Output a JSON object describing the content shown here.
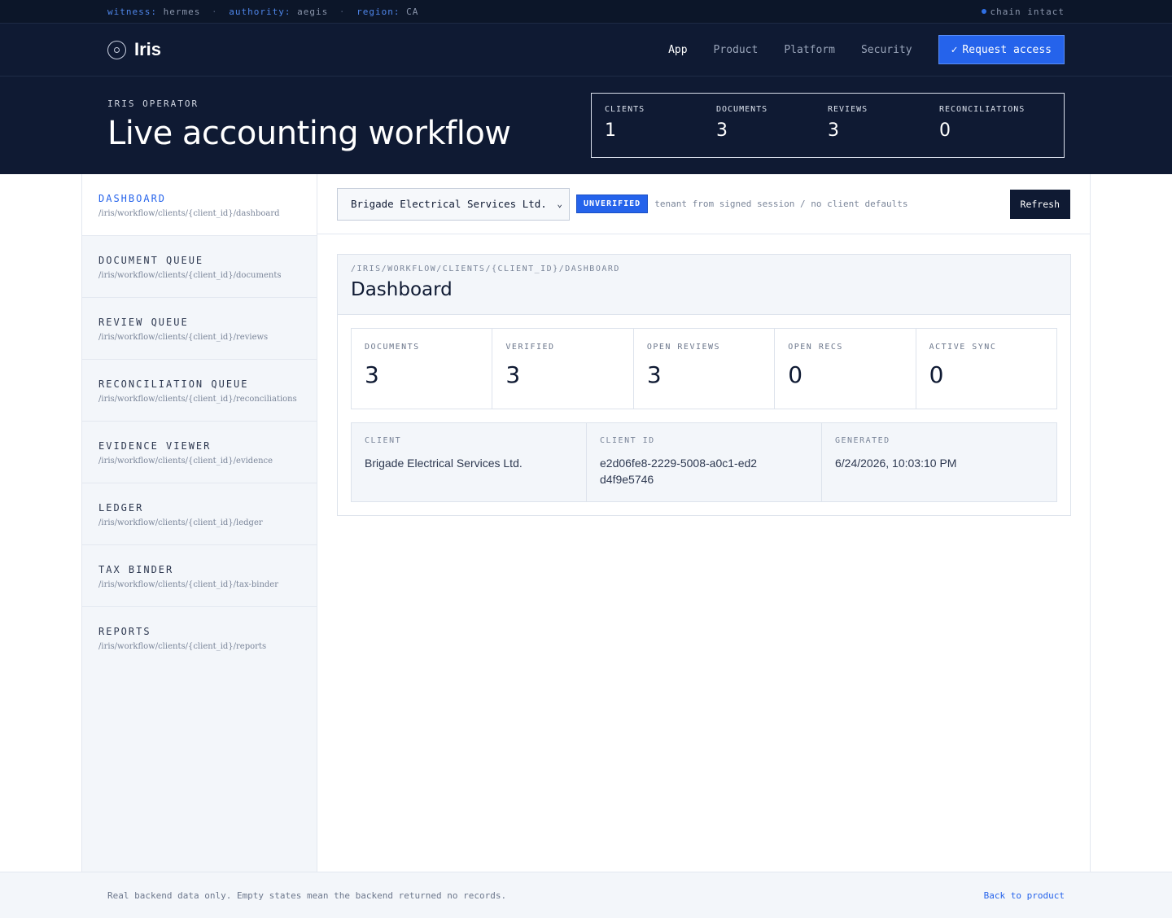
{
  "topstrip": {
    "witness_key": "witness:",
    "witness_val": "hermes",
    "authority_key": "authority:",
    "authority_val": "aegis",
    "region_key": "region:",
    "region_val": "CA",
    "separator": "·",
    "chain_status": "chain intact"
  },
  "nav": {
    "brand": "Iris",
    "links": [
      "App",
      "Product",
      "Platform",
      "Security"
    ],
    "cta_icon": "✓",
    "cta_label": "Request access"
  },
  "hero": {
    "eyebrow": "IRIS OPERATOR",
    "title": "Live accounting workflow",
    "stats": [
      {
        "label": "CLIENTS",
        "value": "1"
      },
      {
        "label": "DOCUMENTS",
        "value": "3"
      },
      {
        "label": "REVIEWS",
        "value": "3"
      },
      {
        "label": "RECONCILIATIONS",
        "value": "0"
      }
    ]
  },
  "sidebar": {
    "items": [
      {
        "title": "DASHBOARD",
        "path": "/iris/workflow/clients/{client_id}/dashboard"
      },
      {
        "title": "DOCUMENT QUEUE",
        "path": "/iris/workflow/clients/{client_id}/documents"
      },
      {
        "title": "REVIEW QUEUE",
        "path": "/iris/workflow/clients/{client_id}/reviews"
      },
      {
        "title": "RECONCILIATION QUEUE",
        "path": "/iris/workflow/clients/{client_id}/reconciliations"
      },
      {
        "title": "EVIDENCE VIEWER",
        "path": "/iris/workflow/clients/{client_id}/evidence"
      },
      {
        "title": "LEDGER",
        "path": "/iris/workflow/clients/{client_id}/ledger"
      },
      {
        "title": "TAX BINDER",
        "path": "/iris/workflow/clients/{client_id}/tax-binder"
      },
      {
        "title": "REPORTS",
        "path": "/iris/workflow/clients/{client_id}/reports"
      }
    ]
  },
  "toolbar": {
    "client_select": "Brigade Electrical Services Ltd.",
    "badge": "UNVERIFIED",
    "tenant_note": "tenant from signed session / no client defaults",
    "refresh_label": "Refresh"
  },
  "panel": {
    "crumb": "/IRIS/WORKFLOW/CLIENTS/{CLIENT_ID}/DASHBOARD",
    "title": "Dashboard",
    "metrics": [
      {
        "label": "DOCUMENTS",
        "value": "3"
      },
      {
        "label": "VERIFIED",
        "value": "3"
      },
      {
        "label": "OPEN REVIEWS",
        "value": "3"
      },
      {
        "label": "OPEN RECS",
        "value": "0"
      },
      {
        "label": "ACTIVE SYNC",
        "value": "0"
      }
    ],
    "info": [
      {
        "label": "CLIENT",
        "value": "Brigade Electrical Services Ltd."
      },
      {
        "label": "CLIENT ID",
        "value": "e2d06fe8-2229-5008-a0c1-ed2d4f9e5746"
      },
      {
        "label": "GENERATED",
        "value": "6/24/2026, 10:03:10 PM"
      }
    ]
  },
  "footer": {
    "note": "Real backend data only. Empty states mean the backend returned no records.",
    "link": "Back to product"
  },
  "colors": {
    "navy": "#0f1a33",
    "accent": "#2563eb",
    "panel_bg": "#f3f6fa"
  }
}
